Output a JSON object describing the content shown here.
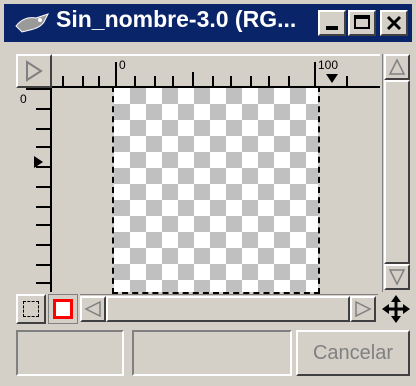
{
  "window": {
    "title": "Sin_nombre-3.0 (RG...",
    "controls": {
      "minimize": "minimize",
      "maximize": "maximize",
      "close": "close"
    }
  },
  "rulers": {
    "horizontal": {
      "labels": [
        "0",
        "100"
      ]
    },
    "vertical": {
      "labels": [
        "0"
      ]
    }
  },
  "status": {
    "field1": "",
    "field2": "",
    "cancel_label": "Cancelar"
  },
  "colors": {
    "titlebar": "#0a246a",
    "window_bg": "#d4d0c8",
    "quickmask_red": "#ff0000"
  }
}
